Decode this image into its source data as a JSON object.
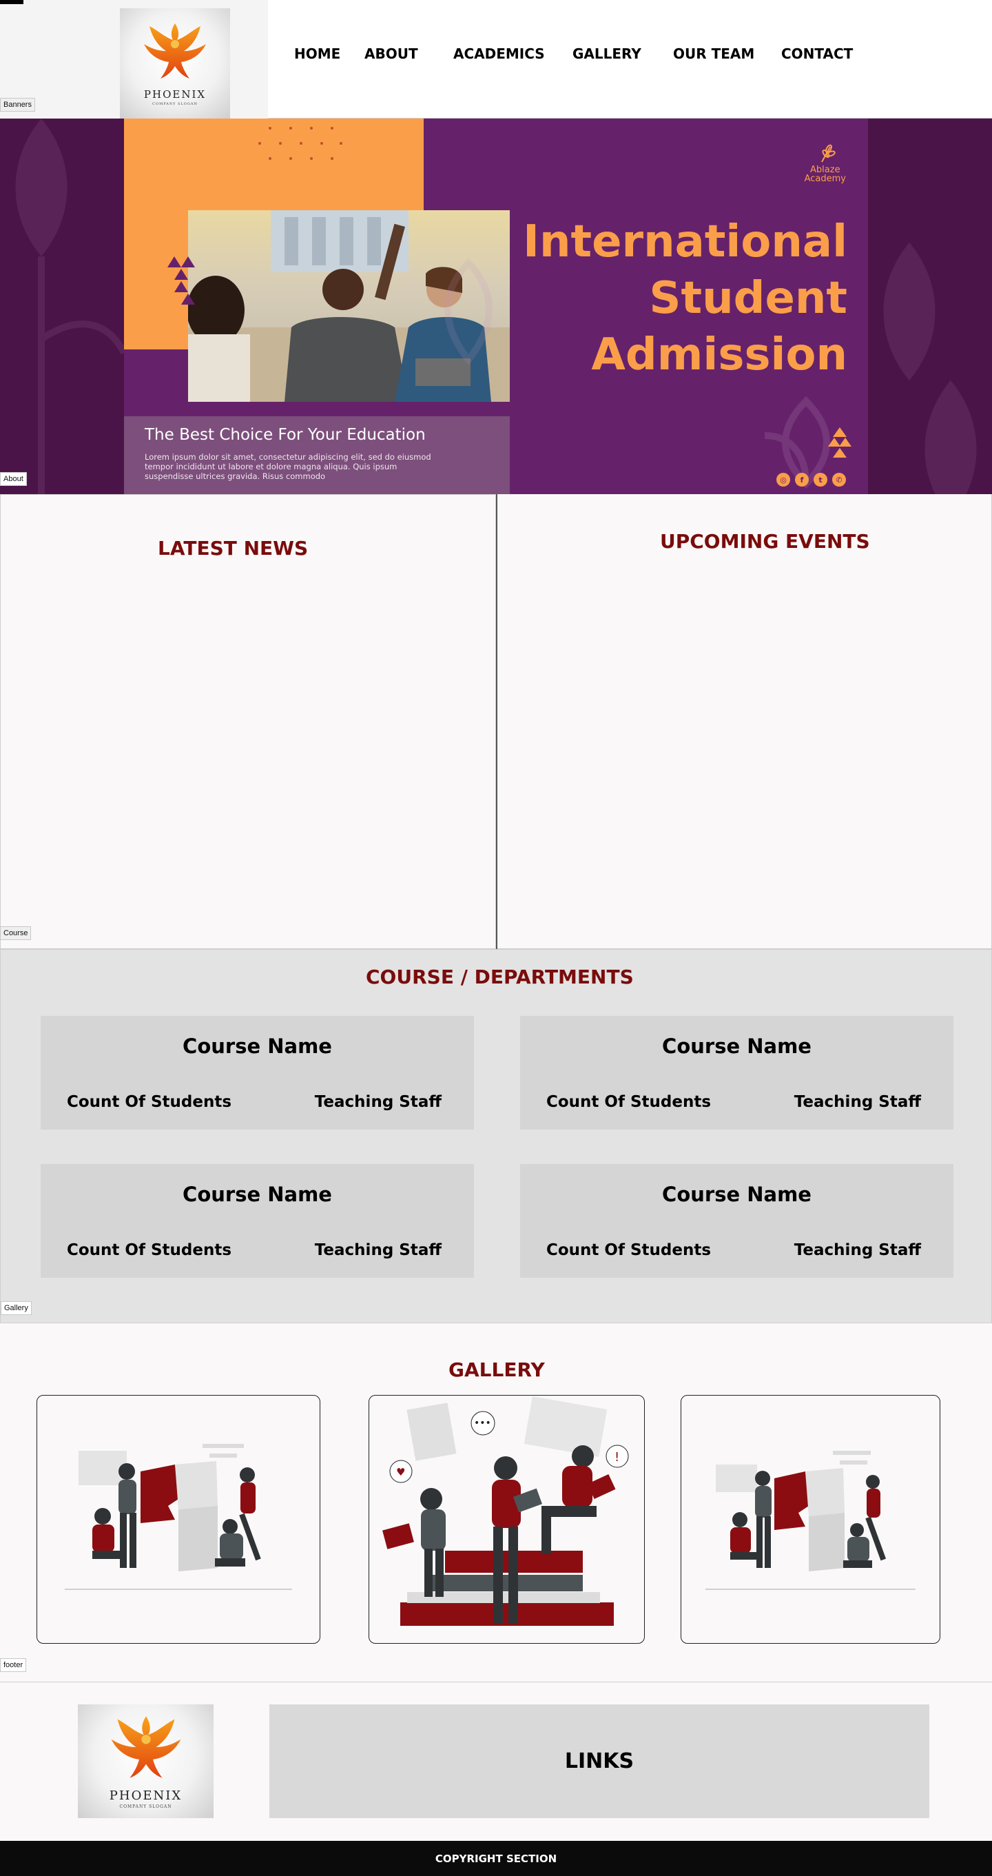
{
  "header": {
    "logo": {
      "name": "PHOENIX",
      "slogan": "COMPANY SLOGAN"
    },
    "nav": [
      {
        "label": "HOME"
      },
      {
        "label": "ABOUT"
      },
      {
        "label": "ACADEMICS"
      },
      {
        "label": "GALLERY"
      },
      {
        "label": "OUR TEAM"
      },
      {
        "label": "CONTACT"
      }
    ]
  },
  "section_tags": {
    "banners": "Banners",
    "about": "About",
    "course": "Course",
    "gallery": "Gallery",
    "footer": "footer"
  },
  "banner": {
    "headline": [
      "International",
      "Student",
      "Admission"
    ],
    "academy": {
      "line1": "Ablaze",
      "line2": "Academy"
    },
    "caption_title": "The Best Choice For Your Education",
    "caption_body": "Lorem ipsum dolor sit amet, consectetur adipiscing elit, sed do eiusmod tempor incididunt ut labore et dolore magna aliqua. Quis ipsum suspendisse ultrices gravida. Risus commodo",
    "socials": [
      "instagram-icon",
      "facebook-icon",
      "twitter-icon",
      "whatsapp-icon"
    ],
    "colors": {
      "orange": "#fb9e4a",
      "purple": "#65226a",
      "deep_purple": "#4b1448"
    }
  },
  "news": {
    "title": "LATEST NEWS"
  },
  "events": {
    "title": "UPCOMING EVENTS"
  },
  "courses": {
    "title": "COURSE / DEPARTMENTS",
    "items": [
      {
        "name": "Course Name",
        "count_label": "Count Of Students",
        "staff_label": "Teaching Staff"
      },
      {
        "name": "Course Name",
        "count_label": "Count Of Students",
        "staff_label": "Teaching Staff"
      },
      {
        "name": "Course Name",
        "count_label": "Count Of Students",
        "staff_label": "Teaching Staff"
      },
      {
        "name": "Course Name",
        "count_label": "Count Of Students",
        "staff_label": "Teaching Staff"
      }
    ]
  },
  "gallery": {
    "title": "GALLERY",
    "items": [
      {
        "icon": "teamwork-puzzle-illustration"
      },
      {
        "icon": "reading-books-illustration"
      },
      {
        "icon": "teamwork-puzzle-illustration"
      }
    ]
  },
  "footer": {
    "links_title": "LINKS",
    "copyright": "COPYRIGHT SECTION"
  },
  "theme": {
    "accent": "#7a0c0c",
    "card_bg": "#d5d5d5"
  }
}
